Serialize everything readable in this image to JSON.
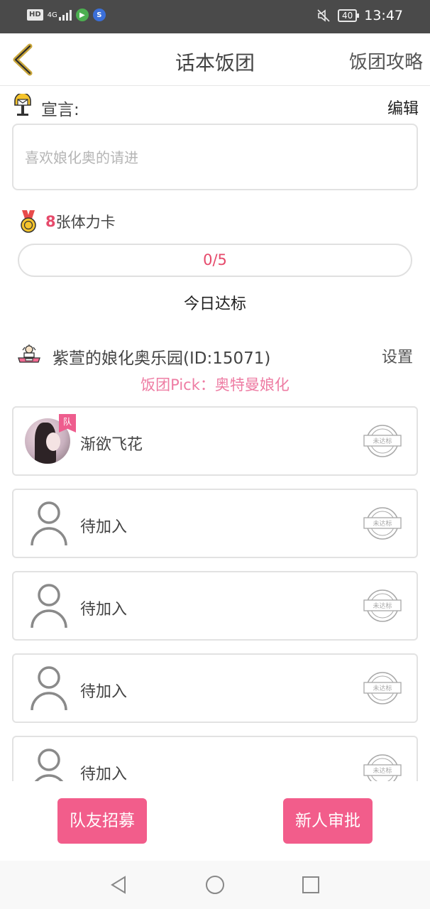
{
  "status_bar": {
    "hd": "HD",
    "network": "4G",
    "battery": "40",
    "time": "13:47",
    "icons": [
      "hd-icon",
      "signal-icon",
      "app-icon",
      "notification-icon",
      "mute-icon",
      "battery-icon"
    ]
  },
  "header": {
    "title": "话本饭团",
    "guide_label": "饭团攻略",
    "back_icon": "chevron-left-icon"
  },
  "declaration": {
    "label": "宣言:",
    "edit_label": "编辑",
    "text": "喜欢娘化奥的请进"
  },
  "stamina": {
    "count": "8",
    "label": "张体力卡"
  },
  "progress": {
    "text": "0/5",
    "fraction": 0,
    "today_label": "今日达标"
  },
  "group": {
    "name": "紫萱的娘化奥乐园(ID:15071)",
    "settings_label": "设置",
    "pick": "饭团Pick：奥特曼娘化"
  },
  "members": [
    {
      "name": "渐欲飞花",
      "badge": "队",
      "status": "未达标",
      "has_avatar": true
    },
    {
      "name": "待加入",
      "status": "未达标",
      "has_avatar": false
    },
    {
      "name": "待加入",
      "status": "未达标",
      "has_avatar": false
    },
    {
      "name": "待加入",
      "status": "未达标",
      "has_avatar": false
    },
    {
      "name": "待加入",
      "status": "未达标",
      "has_avatar": false
    }
  ],
  "actions": {
    "recruit_label": "队友招募",
    "approve_label": "新人审批"
  },
  "navbar": {
    "icons": [
      "back-triangle-icon",
      "home-circle-icon",
      "recents-square-icon"
    ]
  },
  "colors": {
    "accent": "#f25d8b",
    "highlight": "#e64a6b",
    "pick_text": "#ee7ca3",
    "status_bar": "#4a4a4a"
  }
}
